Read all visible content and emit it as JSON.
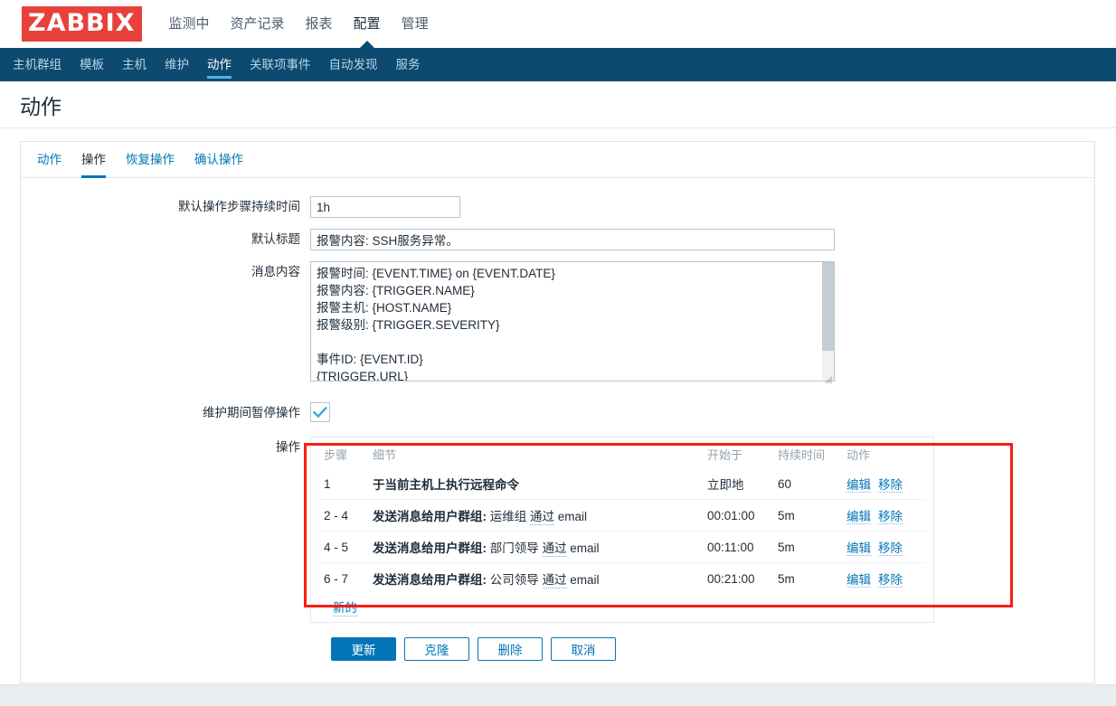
{
  "brand": {
    "logo_text": "ZABBIX",
    "logo_bg": "#e8403a"
  },
  "main_nav": [
    {
      "label": "监测中",
      "active": false
    },
    {
      "label": "资产记录",
      "active": false
    },
    {
      "label": "报表",
      "active": false
    },
    {
      "label": "配置",
      "active": true
    },
    {
      "label": "管理",
      "active": false
    }
  ],
  "sub_nav": [
    {
      "label": "主机群组",
      "active": false
    },
    {
      "label": "模板",
      "active": false
    },
    {
      "label": "主机",
      "active": false
    },
    {
      "label": "维护",
      "active": false
    },
    {
      "label": "动作",
      "active": true
    },
    {
      "label": "关联项事件",
      "active": false
    },
    {
      "label": "自动发现",
      "active": false
    },
    {
      "label": "服务",
      "active": false
    }
  ],
  "page": {
    "title": "动作"
  },
  "tabs": [
    {
      "label": "动作",
      "active": false
    },
    {
      "label": "操作",
      "active": true
    },
    {
      "label": "恢复操作",
      "active": false
    },
    {
      "label": "确认操作",
      "active": false
    }
  ],
  "form": {
    "default_duration": {
      "label": "默认操作步骤持续时间",
      "value": "1h"
    },
    "default_subject": {
      "label": "默认标题",
      "value": "报警内容: SSH服务异常。"
    },
    "message_body": {
      "label": "消息内容",
      "value": "报警时间: {EVENT.TIME} on {EVENT.DATE}\n报警内容: {TRIGGER.NAME}\n报警主机: {HOST.NAME}\n报警级别: {TRIGGER.SEVERITY}\n\n事件ID: {EVENT.ID}\n{TRIGGER.URL}"
    },
    "pause_maintenance": {
      "label": "维护期间暂停操作",
      "checked": true
    },
    "operations": {
      "label": "操作"
    }
  },
  "ops_table": {
    "headers": [
      "步骤",
      "细节",
      "开始于",
      "持续时间",
      "动作"
    ],
    "rows": [
      {
        "step": "1",
        "detail_bold": "于当前主机上执行远程命令",
        "detail_via": "",
        "detail_target": "",
        "detail_tail": "",
        "start": "立即地",
        "duration": "60",
        "edit": "编辑",
        "remove": "移除"
      },
      {
        "step": "2 - 4",
        "detail_bold": "发送消息给用户群组:",
        "detail_target": "运维组",
        "detail_via": "通过",
        "detail_tail": "email",
        "start": "00:01:00",
        "duration": "5m",
        "edit": "编辑",
        "remove": "移除"
      },
      {
        "step": "4 - 5",
        "detail_bold": "发送消息给用户群组:",
        "detail_target": "部门领导",
        "detail_via": "通过",
        "detail_tail": "email",
        "start": "00:11:00",
        "duration": "5m",
        "edit": "编辑",
        "remove": "移除"
      },
      {
        "step": "6 - 7",
        "detail_bold": "发送消息给用户群组:",
        "detail_target": "公司领导",
        "detail_via": "通过",
        "detail_tail": "email",
        "start": "00:21:00",
        "duration": "5m",
        "edit": "编辑",
        "remove": "移除"
      }
    ],
    "new_link": "新的"
  },
  "buttons": {
    "update": "更新",
    "clone": "克隆",
    "delete": "删除",
    "cancel": "取消"
  },
  "colors": {
    "accent": "#0275b8",
    "subnav_bg": "#0c4a70",
    "highlight_box": "#fb1c12",
    "logo_bg": "#e8403a"
  }
}
